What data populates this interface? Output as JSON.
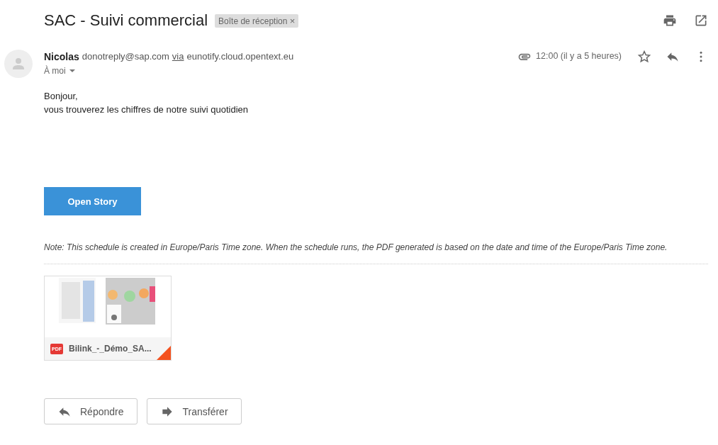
{
  "subject": "SAC - Suivi commercial",
  "label": {
    "text": "Boîte de réception",
    "close": "×"
  },
  "sender": {
    "name": "Nicolas",
    "email": "donotreply@sap.com",
    "via": "via",
    "domain": "eunotify.cloud.opentext.eu",
    "to": "À moi"
  },
  "time": "12:00 (il y a 5 heures)",
  "starred": false,
  "body": [
    "Bonjour,",
    "vous trouverez les chiffres de notre suivi quotidien"
  ],
  "cta": "Open Story",
  "note": "Note: This schedule is created in Europe/Paris Time zone. When the schedule runs, the PDF generated is based on the date and time of the Europe/Paris Time zone.",
  "attachment": {
    "badge": "PDF",
    "name": "Bilink_-_Démo_SA..."
  },
  "actions": [
    "Répondre",
    "Transférer"
  ]
}
